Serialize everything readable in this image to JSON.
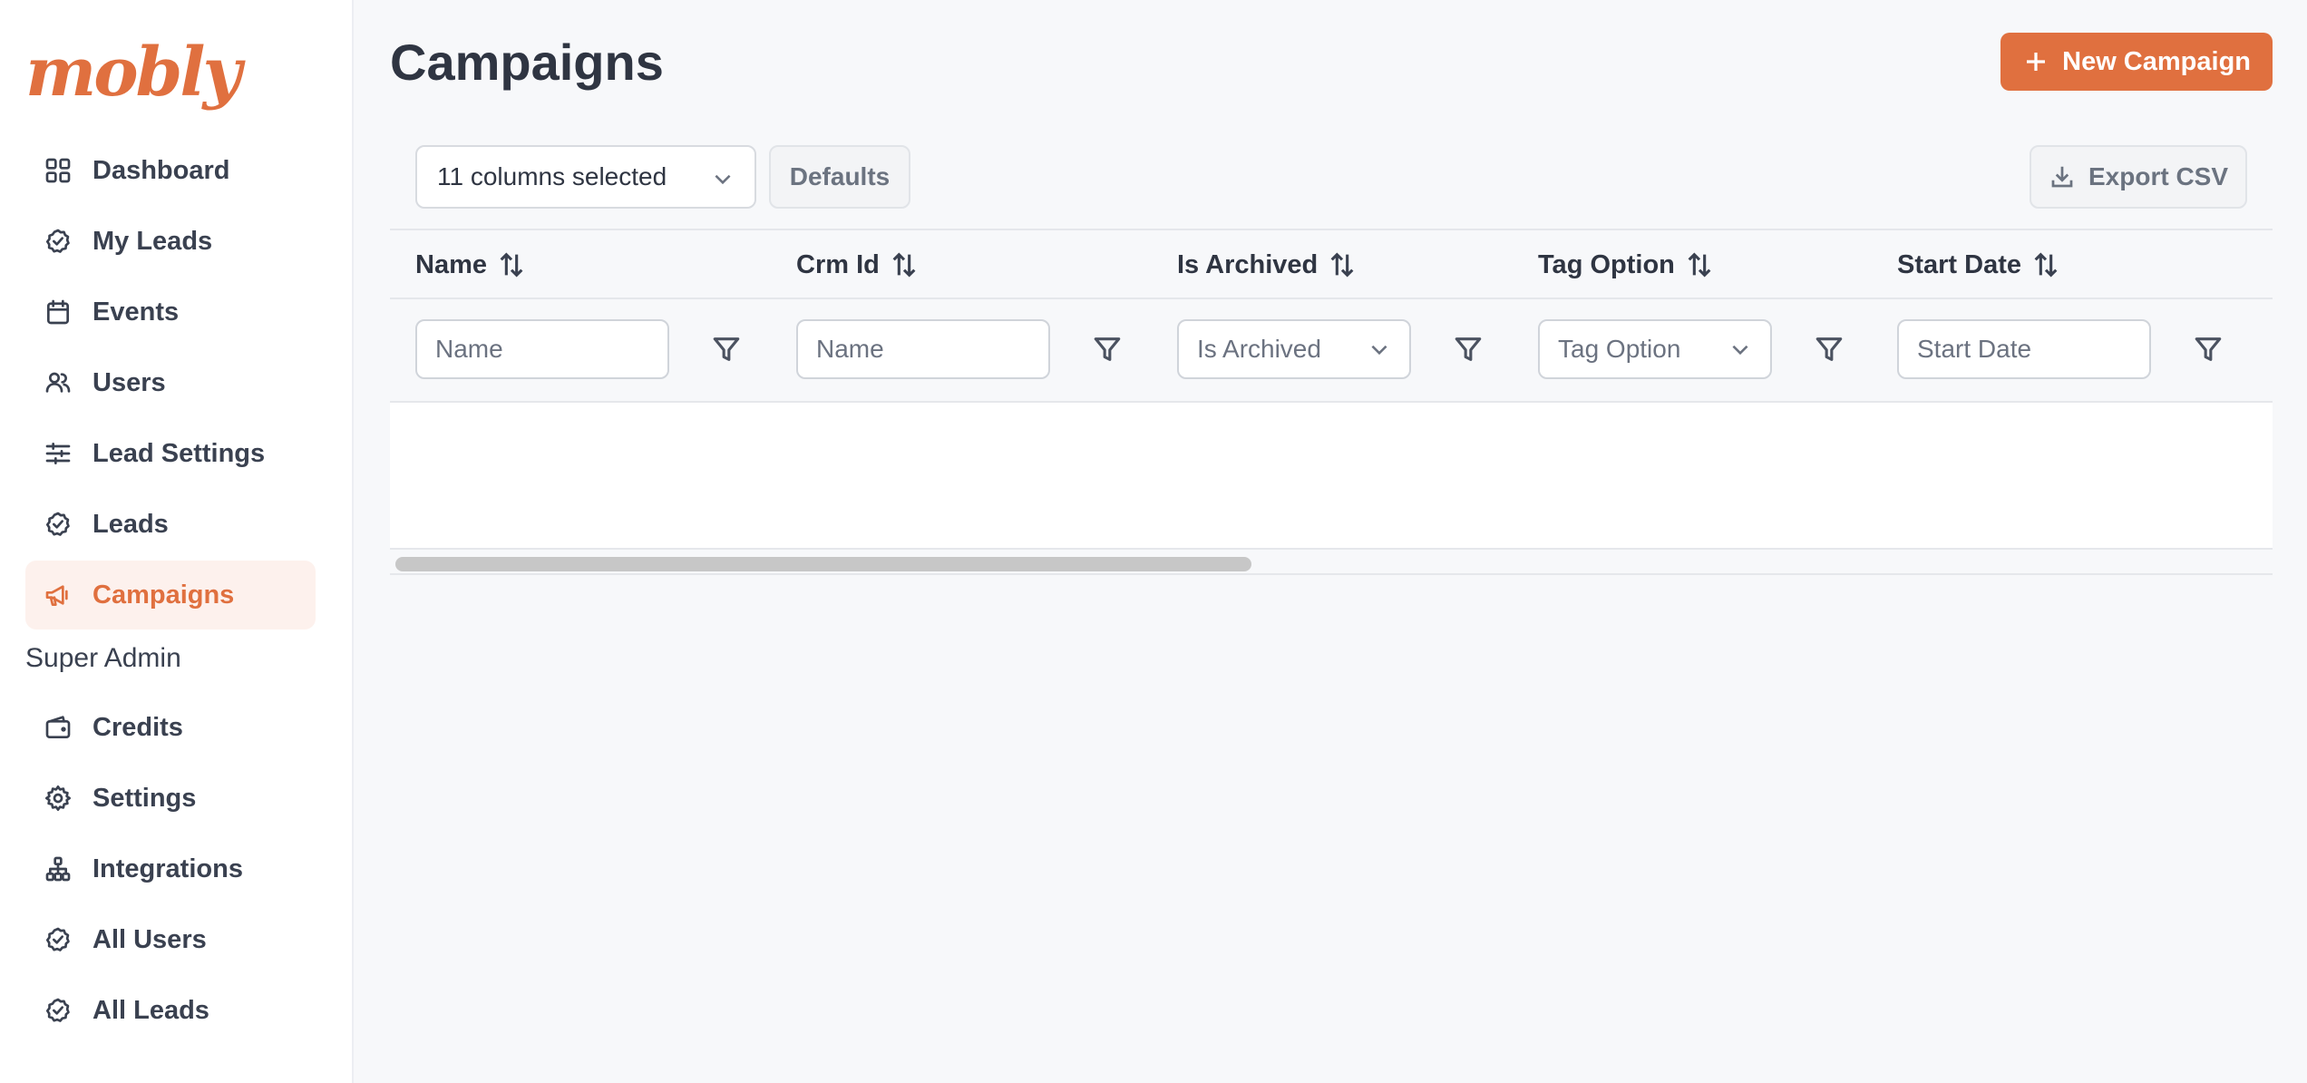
{
  "app": {
    "logo_text": "mobly",
    "brand_color": "#e0703f"
  },
  "sidebar": {
    "items": [
      {
        "label": "Dashboard",
        "icon": "grid-icon"
      },
      {
        "label": "My Leads",
        "icon": "check-circle-icon"
      },
      {
        "label": "Events",
        "icon": "calendar-icon"
      },
      {
        "label": "Users",
        "icon": "users-icon"
      },
      {
        "label": "Lead Settings",
        "icon": "sliders-icon"
      },
      {
        "label": "Leads",
        "icon": "check-circle-icon"
      },
      {
        "label": "Campaigns",
        "icon": "megaphone-icon",
        "active": true
      }
    ],
    "section_label": "Super Admin",
    "admin_items": [
      {
        "label": "Credits",
        "icon": "wallet-icon"
      },
      {
        "label": "Settings",
        "icon": "gear-icon"
      },
      {
        "label": "Integrations",
        "icon": "network-icon"
      },
      {
        "label": "All Users",
        "icon": "check-circle-icon"
      },
      {
        "label": "All Leads",
        "icon": "check-circle-icon"
      }
    ]
  },
  "header": {
    "title": "Campaigns",
    "new_button_label": "New Campaign"
  },
  "toolbar": {
    "columns_selected": "11 columns selected",
    "defaults_label": "Defaults",
    "export_label": "Export CSV"
  },
  "table": {
    "columns": [
      {
        "label": "Name",
        "filter_type": "input",
        "filter_placeholder": "Name"
      },
      {
        "label": "Crm Id",
        "filter_type": "input",
        "filter_placeholder": "Name"
      },
      {
        "label": "Is Archived",
        "filter_type": "select",
        "filter_placeholder": "Is Archived"
      },
      {
        "label": "Tag Option",
        "filter_type": "select",
        "filter_placeholder": "Tag Option"
      },
      {
        "label": "Start Date",
        "filter_type": "input",
        "filter_placeholder": "Start Date"
      }
    ],
    "rows": []
  }
}
